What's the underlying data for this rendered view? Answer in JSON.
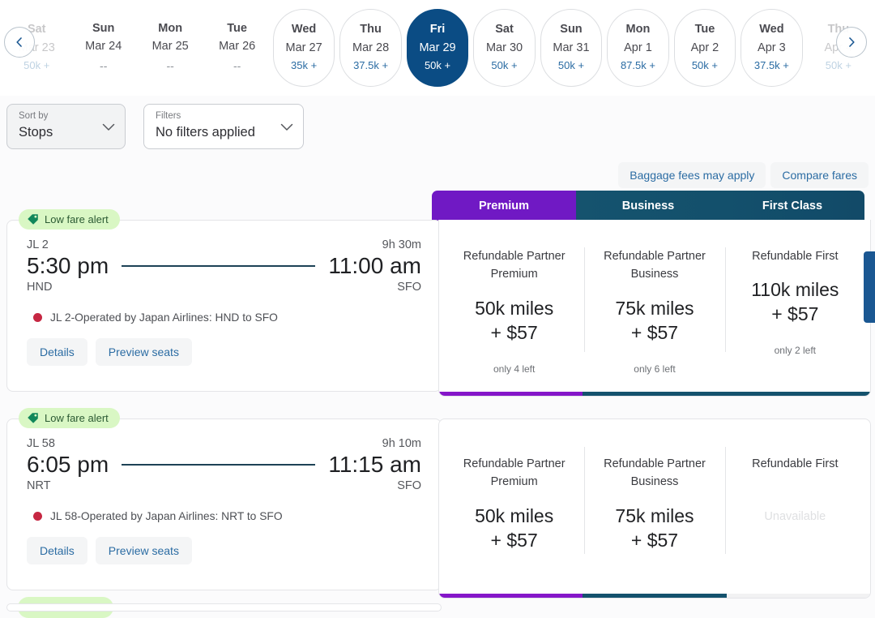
{
  "date_strip": {
    "prev_label": "Previous dates",
    "next_label": "Next dates",
    "days": [
      {
        "dow": "Sat",
        "date": "Mar 23",
        "price": "50k +",
        "state": "faded"
      },
      {
        "dow": "Sun",
        "date": "Mar 24",
        "price": "--",
        "state": "plain"
      },
      {
        "dow": "Mon",
        "date": "Mar 25",
        "price": "--",
        "state": "plain"
      },
      {
        "dow": "Tue",
        "date": "Mar 26",
        "price": "--",
        "state": "plain"
      },
      {
        "dow": "Wed",
        "date": "Mar 27",
        "price": "35k +",
        "state": "bordered"
      },
      {
        "dow": "Thu",
        "date": "Mar 28",
        "price": "37.5k +",
        "state": "bordered"
      },
      {
        "dow": "Fri",
        "date": "Mar 29",
        "price": "50k +",
        "state": "selected"
      },
      {
        "dow": "Sat",
        "date": "Mar 30",
        "price": "50k +",
        "state": "bordered"
      },
      {
        "dow": "Sun",
        "date": "Mar 31",
        "price": "50k +",
        "state": "bordered"
      },
      {
        "dow": "Mon",
        "date": "Apr 1",
        "price": "87.5k +",
        "state": "bordered"
      },
      {
        "dow": "Tue",
        "date": "Apr 2",
        "price": "50k +",
        "state": "bordered"
      },
      {
        "dow": "Wed",
        "date": "Apr 3",
        "price": "37.5k +",
        "state": "bordered"
      },
      {
        "dow": "Thu",
        "date": "Apr 4",
        "price": "50k +",
        "state": "faded"
      }
    ]
  },
  "controls": {
    "sort_by": {
      "label": "Sort by",
      "value": "Stops"
    },
    "filters": {
      "label": "Filters",
      "value": "No filters applied"
    }
  },
  "links": {
    "baggage": "Baggage fees may apply",
    "compare": "Compare fares"
  },
  "cabin_tabs": [
    {
      "label": "Premium",
      "color": "#7019c4"
    },
    {
      "label": "Business",
      "color": "#15536e"
    },
    {
      "label": "First Class",
      "color": "#13506c"
    }
  ],
  "flights": [
    {
      "alert": "Low fare alert",
      "flight_no": "JL 2",
      "duration": "9h 30m",
      "depart_time": "5:30 pm",
      "arrive_time": "11:00 am",
      "origin": "HND",
      "destination": "SFO",
      "operated_by": "JL 2-Operated by Japan Airlines: HND to SFO",
      "details_label": "Details",
      "preview_label": "Preview seats",
      "fares": [
        {
          "name": "Refundable Partner Premium",
          "price": "50k miles\n+ $57",
          "seats_left": "only 4 left",
          "available": true
        },
        {
          "name": "Refundable Partner Business",
          "price": "75k miles\n+ $57",
          "seats_left": "only 6 left",
          "available": true
        },
        {
          "name": "Refundable First",
          "price": "110k miles\n+ $57",
          "seats_left": "only 2 left",
          "available": true
        }
      ]
    },
    {
      "alert": "Low fare alert",
      "flight_no": "JL 58",
      "duration": "9h 10m",
      "depart_time": "6:05 pm",
      "arrive_time": "11:15 am",
      "origin": "NRT",
      "destination": "SFO",
      "operated_by": "JL 58-Operated by Japan Airlines: NRT to SFO",
      "details_label": "Details",
      "preview_label": "Preview seats",
      "fares": [
        {
          "name": "Refundable Partner Premium",
          "price": "50k miles\n+ $57",
          "seats_left": "",
          "available": true
        },
        {
          "name": "Refundable Partner Business",
          "price": "75k miles\n+ $57",
          "seats_left": "",
          "available": true
        },
        {
          "name": "Refundable First",
          "price": "",
          "seats_left": "",
          "available": false,
          "unavailable_label": "Unavailable"
        }
      ]
    }
  ],
  "colors": {
    "selected_day": "#0b4c84",
    "premium": "#7019c4",
    "business": "#14526d",
    "link": "#2b6ca3",
    "alert_bg": "#d9f7c4"
  }
}
